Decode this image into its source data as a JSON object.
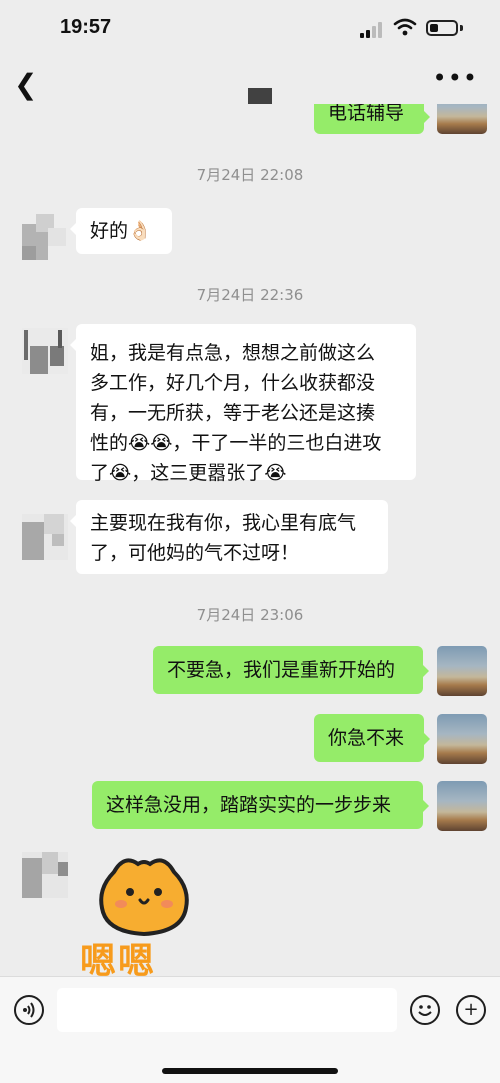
{
  "status_bar": {
    "time": "19:57",
    "battery_level": 0.35
  },
  "nav": {
    "back_icon": "chevron-left-icon",
    "more_icon": "ellipsis-icon"
  },
  "messages": {
    "m0": "电话辅导",
    "t1": "7月24日 22:08",
    "m1": "好的👌🏻",
    "t2": "7月24日 22:36",
    "m2": [
      "姐，我是有点急，想想之前做这么",
      "多工作，好几个月，什么收获都没",
      "有，一无所获，等于老公还是这揍",
      "性的😭😭，干了一半的三也白进攻",
      "了😭，这三更嚣张了😭"
    ],
    "m3": [
      "主要现在我有你，我心里有底气",
      "了，可他妈的气不过呀！"
    ],
    "t3": "7月24日 23:06",
    "m4": "不要急，我们是重新开始的",
    "m5": "你急不来",
    "m6": "这样急没用，踏踏实实的一步步来",
    "sticker_text": "嗯嗯"
  },
  "input_bar": {
    "voice_icon": "voice-icon",
    "emoji_icon": "emoji-icon",
    "plus_icon": "plus-icon"
  },
  "colors": {
    "background": "#ededed",
    "outgoing_bubble": "#95ec69",
    "incoming_bubble": "#ffffff",
    "timestamp": "#8f8f8f"
  }
}
